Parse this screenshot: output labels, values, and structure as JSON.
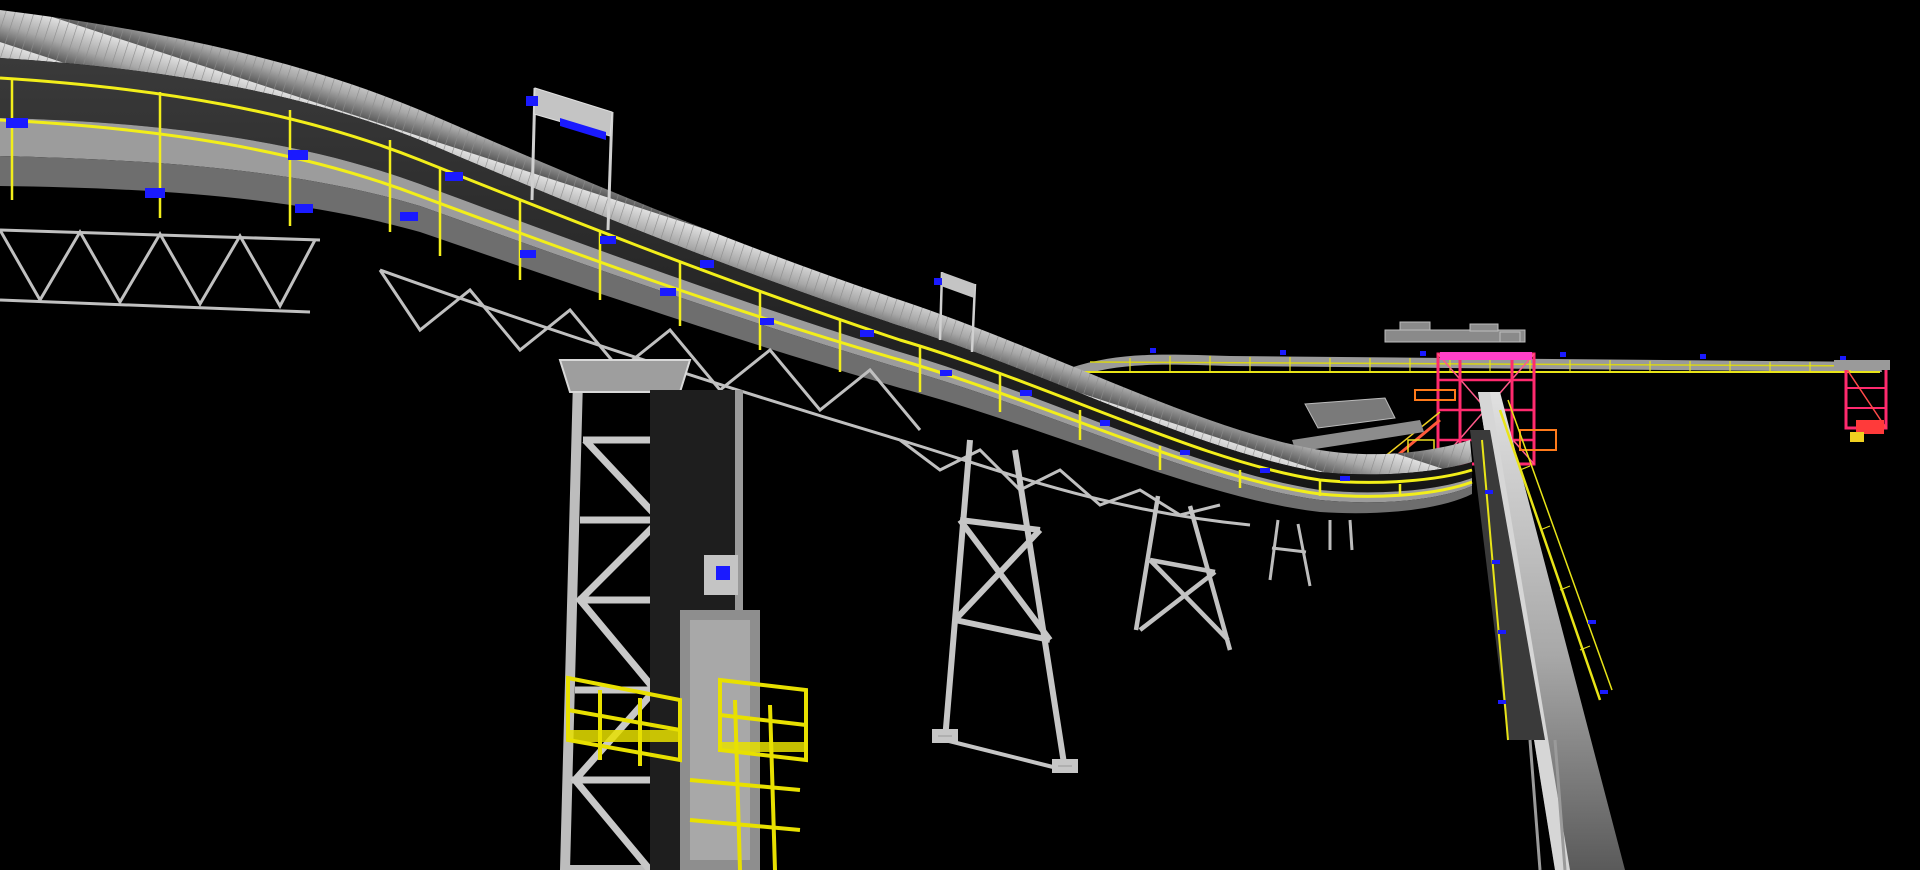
{
  "scene": {
    "subject": "conveyor-gallery-3d-render",
    "colors": {
      "background": "#000000",
      "steel": "#b4b4b4",
      "steel_dark": "#6e6e6e",
      "cover": "#c9c9c9",
      "handrail": "#f2ee1a",
      "belt": "#2a2a2a",
      "marker": "#1a1aff",
      "transfer_tower": "#ff2a6e",
      "transfer_tower_accent": "#ff7a1a",
      "platform": "#e8e000"
    }
  }
}
